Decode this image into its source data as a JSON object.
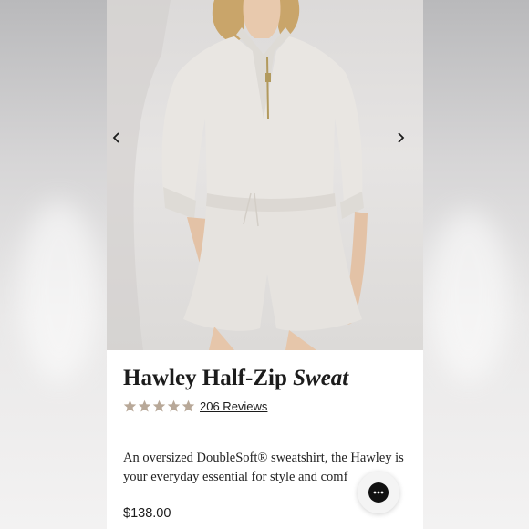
{
  "product": {
    "title_main": "Hawley Half-Zip",
    "title_italic": "Sweat",
    "rating_stars": 5,
    "reviews_label": "206 Reviews",
    "description": "An oversized DoubleSoft® sweatshirt, the Hawley is your everyday essential for style and comf",
    "price": "$138.00"
  },
  "gallery": {
    "prev_icon": "chevron-left-icon",
    "next_icon": "chevron-right-icon"
  },
  "chat": {
    "icon": "chat-dots-icon"
  },
  "colors": {
    "star": "#b8a898",
    "text": "#1c1c1c",
    "chat_bg": "#111111"
  }
}
